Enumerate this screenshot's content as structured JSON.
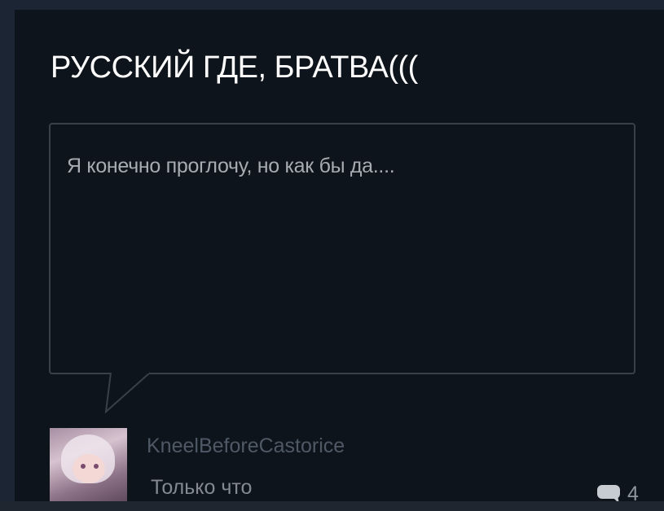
{
  "topic": {
    "title": "РУССКИЙ ГДЕ, БРАТВА((("
  },
  "post": {
    "text": "Я конечно проглочу, но как бы да....",
    "author": "KneelBeforeCastorice",
    "time": "Только что",
    "comment_count": "4"
  },
  "icons": {
    "comment": "speech-bubble-icon",
    "avatar": "anime-avatar-image"
  },
  "colors": {
    "background": "#0e141b",
    "title": "#ffffff",
    "bubble_border": "#3a4049",
    "text_muted": "#a7acb2"
  }
}
